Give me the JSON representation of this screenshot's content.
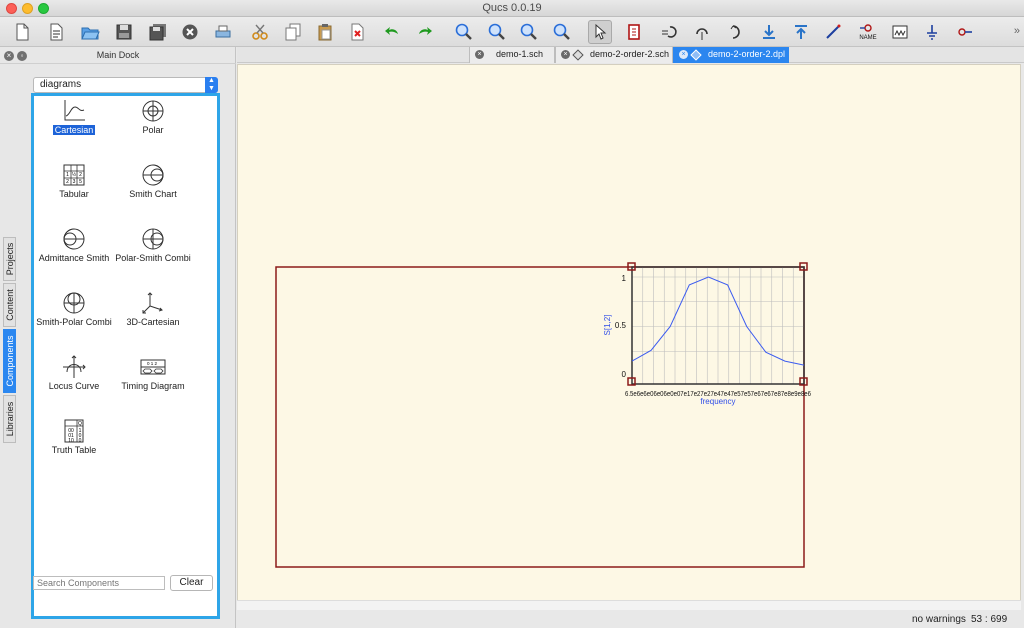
{
  "window": {
    "title": "Qucs 0.0.19"
  },
  "toolbar": {
    "buttons": [
      "new-file",
      "new-text",
      "open",
      "save",
      "save-all",
      "close",
      "print",
      "cut",
      "copy",
      "paste",
      "delete",
      "undo",
      "redo",
      "view-all",
      "view-1-1",
      "zoom-in",
      "zoom-out",
      "select",
      "insert-equation",
      "rotate",
      "mirror-x",
      "mirror-y",
      "enter-subcircuit",
      "exit-subcircuit",
      "wire",
      "label-name",
      "port",
      "ground",
      "marker"
    ],
    "name_label": "NAME",
    "colors": {
      "green_arrow": "#1f9a1f",
      "blue_lens": "#2a6ed8"
    }
  },
  "dock": {
    "title": "Main Dock",
    "category": "diagrams",
    "side_tabs": [
      "Projects",
      "Content",
      "Components",
      "Libraries"
    ],
    "active_side_tab": "Components",
    "components": [
      {
        "label": "Cartesian",
        "icon": "cartesian-icon",
        "selected": true
      },
      {
        "label": "Polar",
        "icon": "polar-icon",
        "selected": false
      },
      {
        "label": "Tabular",
        "icon": "tabular-icon",
        "selected": false
      },
      {
        "label": "Smith Chart",
        "icon": "smith-chart-icon",
        "selected": false
      },
      {
        "label": "Admittance Smith",
        "icon": "admittance-smith-icon",
        "selected": false
      },
      {
        "label": "Polar-Smith Combi",
        "icon": "polar-smith-icon",
        "selected": false
      },
      {
        "label": "Smith-Polar Combi",
        "icon": "smith-polar-icon",
        "selected": false
      },
      {
        "label": "3D-Cartesian",
        "icon": "3d-cartesian-icon",
        "selected": false
      },
      {
        "label": "Locus Curve",
        "icon": "locus-curve-icon",
        "selected": false
      },
      {
        "label": "Timing Diagram",
        "icon": "timing-diagram-icon",
        "selected": false
      },
      {
        "label": "Truth Table",
        "icon": "truth-table-icon",
        "selected": false
      }
    ],
    "search_placeholder": "Search Components",
    "clear_label": "Clear"
  },
  "tabs": [
    {
      "label": "demo-1.sch",
      "active": false
    },
    {
      "label": "demo-2-order-2.sch",
      "active": false
    },
    {
      "label": "demo-2-order-2.dpl",
      "active": true
    }
  ],
  "diagram": {
    "ylabel": "S[1,2]",
    "xlabel": "frequency",
    "yticks": [
      "1",
      "0.5",
      "0"
    ],
    "xtick_text": "6.5e6e6e06e06e0e07e17e27e27e47e47e57e57e67e67e87e8e9e8e6",
    "ylim": [
      0,
      1
    ],
    "y_values": [
      0.15,
      0.26,
      0.5,
      0.92,
      1.0,
      0.92,
      0.5,
      0.24,
      0.15,
      0.11
    ],
    "colors": {
      "frame": "#8b1a1a",
      "plot_border": "#333333",
      "grid": "#bdbdbd",
      "curve": "#3c5cf0",
      "label": "#2f4de8"
    }
  },
  "status": {
    "warnings": "no warnings",
    "coords": "53 : 699"
  }
}
